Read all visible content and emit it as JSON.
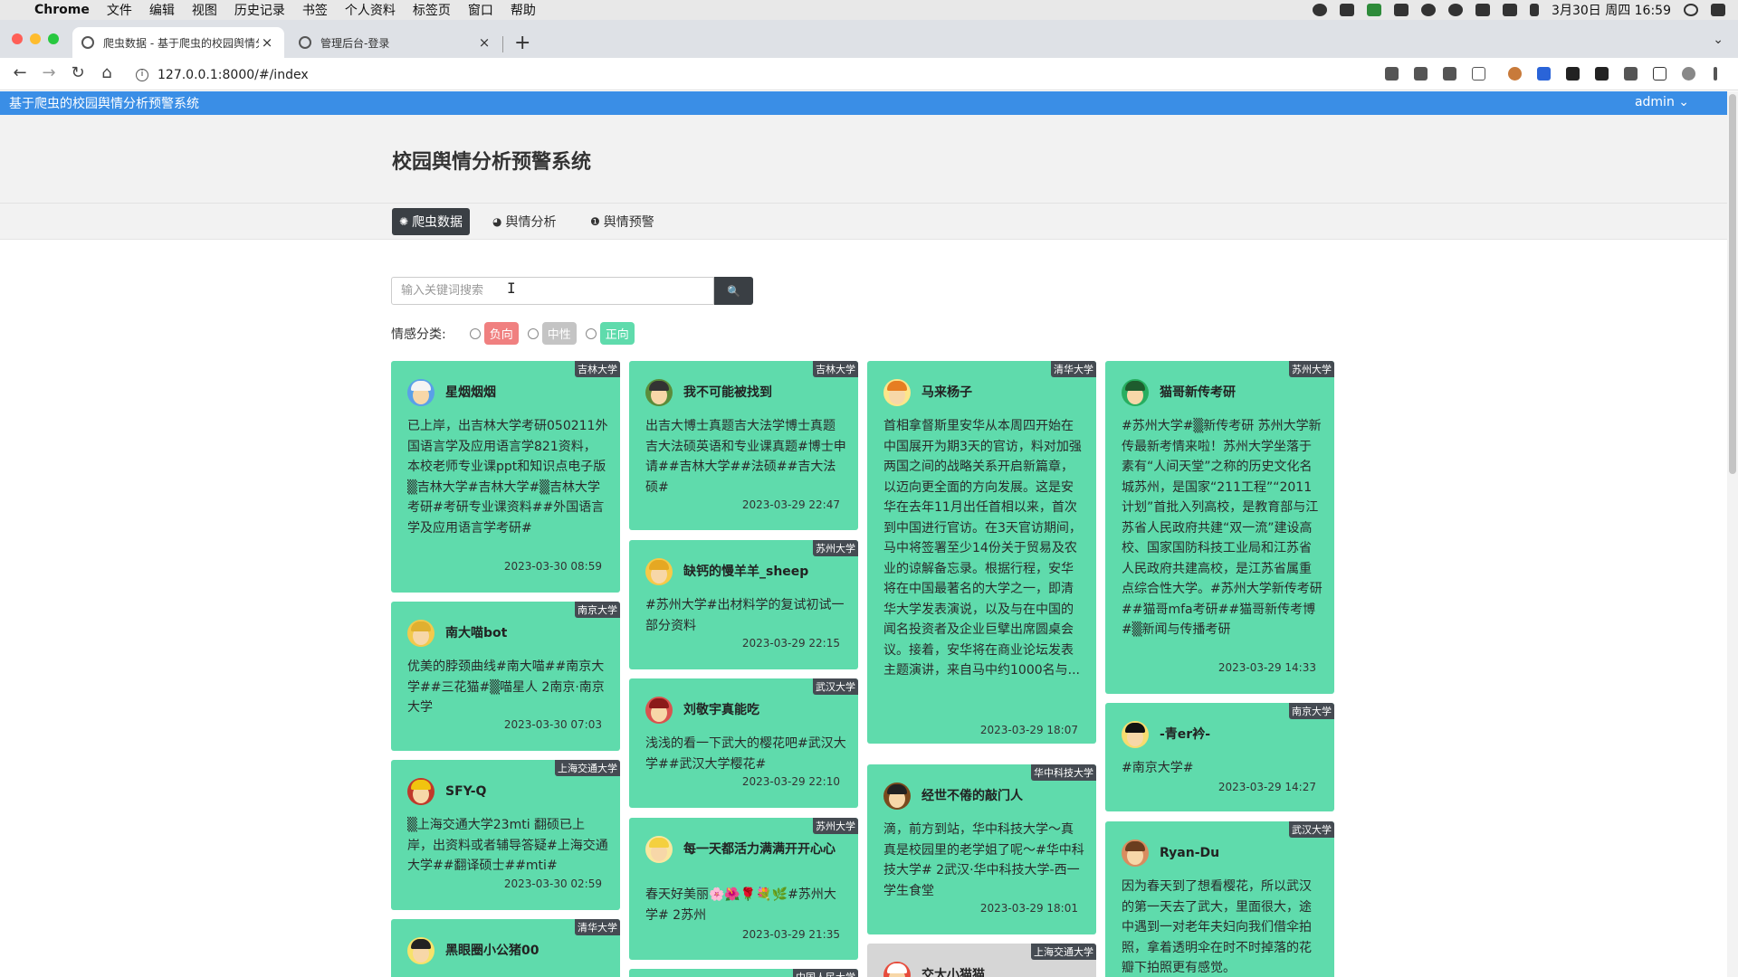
{
  "menubar": {
    "app_name": "Chrome",
    "items": [
      "文件",
      "编辑",
      "视图",
      "历史记录",
      "书签",
      "个人资料",
      "标签页",
      "窗口",
      "帮助"
    ],
    "clock": "3月30日 周四  16:59"
  },
  "tabs": [
    {
      "title": "爬虫数据 - 基于爬虫的校园舆情分析",
      "close": "×"
    },
    {
      "title": "管理后台-登录",
      "close": "×"
    }
  ],
  "newtab": "+",
  "toolbar": {
    "url": "127.0.0.1:8000/#/index",
    "back": "←",
    "forward": "→",
    "reload": "↻",
    "home": "⌂"
  },
  "appbar": {
    "title": "基于爬虫的校园舆情分析预警系统",
    "user": "admin ⌄"
  },
  "page": {
    "heading": "校园舆情分析预警系统",
    "nav": [
      {
        "icon": "✺",
        "label": "爬虫数据"
      },
      {
        "icon": "◕",
        "label": "舆情分析"
      },
      {
        "icon": "❶",
        "label": "舆情预警"
      }
    ],
    "search": {
      "placeholder": "输入关键词搜索",
      "button": "🔍"
    },
    "sentiment": {
      "label": "情感分类:",
      "options": [
        {
          "label": "负向",
          "color": "#f08080"
        },
        {
          "label": "中性",
          "color": "#c4c4c4"
        },
        {
          "label": "正向",
          "color": "#5fdbac"
        }
      ]
    }
  },
  "cards": [
    {
      "school": "吉林大学",
      "name": "星烟烟烟",
      "content": "已上岸，出吉林大学考研050211外国语言学及应用语言学821资料，本校老师专业课ppt和知识点电子版▒吉林大学#吉林大学#▒吉林大学考研#考研专业课资料##外国语言学及应用语言学考研#",
      "date": "2023-03-30 08:59"
    },
    {
      "school": "南京大学",
      "name": "南大喵bot",
      "content": "优美的脖颈曲线#南大喵##南京大学##三花猫#▒喵星人 2南京·南京大学",
      "date": "2023-03-30 07:03"
    },
    {
      "school": "上海交通大学",
      "name": "SFY-Q",
      "content": "▒上海交通大学23mti 翻硕已上岸，出资料或者辅导答疑#上海交通大学##翻译硕士##mti#",
      "date": "2023-03-30 02:59"
    },
    {
      "school": "清华大学",
      "name": "黑眼圈小公猪00",
      "content": "",
      "date": ""
    },
    {
      "school": "吉林大学",
      "name": "我不可能被找到",
      "content": "出吉大博士真题吉大法学博士真题吉大法硕英语和专业课真题#博士申请##吉林大学##法硕##吉大法硕#",
      "date": "2023-03-29 22:47"
    },
    {
      "school": "苏州大学",
      "name": "缺钙的慢羊羊_sheep",
      "content": "#苏州大学#出材料学的复试初试一部分资料",
      "date": "2023-03-29 22:15"
    },
    {
      "school": "武汉大学",
      "name": "刘敬宇真能吃",
      "content": "浅浅的看一下武大的樱花吧#武汉大学##武汉大学樱花#",
      "date": "2023-03-29 22:10"
    },
    {
      "school": "苏州大学",
      "name": "每一天都活力满满开开心心",
      "content": "春天好美丽🌸🌺🌹💐🌿#苏州大学# 2苏州",
      "date": "2023-03-29 21:35"
    },
    {
      "school": "中国人民大学",
      "name": "",
      "content": "",
      "date": ""
    },
    {
      "school": "清华大学",
      "name": "马来杨子",
      "content": "首相拿督斯里安华从本周四开始在中国展开为期3天的官访，料对加强两国之间的战略关系开启新篇章，以迈向更全面的方向发展。这是安华在去年11月出任首相以来，首次到中国进行官访。在3天官访期间，马中将签署至少14份关于贸易及农业的谅解备忘录。根据行程，安华将在中国最著名的大学之一，即清华大学发表演说，以及与在中国的闻名投资者及企业巨擘出席圆桌会议。接着，安华将在商业论坛发表主题演讲，来自马中约1000名与...",
      "date": "2023-03-29 18:07"
    },
    {
      "school": "华中科技大学",
      "name": "经世不倦的敲门人",
      "content": "滴，前方到站，华中科技大学～真真是校园里的老学姐了呢～#华中科技大学# 2武汉·华中科技大学-西一学生食堂",
      "date": "2023-03-29 18:01"
    },
    {
      "school": "上海交通大学",
      "name": "交大小猫猫",
      "content": "",
      "date": ""
    },
    {
      "school": "苏州大学",
      "name": "猫哥新传考研",
      "content": "#苏州大学#▒新传考研 苏州大学新传最新考情来啦！苏州大学坐落于素有“人间天堂”之称的历史文化名城苏州，是国家“211工程”“2011计划”首批入列高校，是教育部与江苏省人民政府共建“双一流”建设高校、国家国防科技工业局和江苏省人民政府共建高校，是江苏省属重点综合性大学。#苏州大学新传考研##猫哥mfa考研##猫哥新传考博#▒新闻与传播考研",
      "date": "2023-03-29 14:33"
    },
    {
      "school": "南京大学",
      "name": "-青er衿-",
      "content": "#南京大学#",
      "date": "2023-03-29 14:27"
    },
    {
      "school": "武汉大学",
      "name": "Ryan-Du",
      "content": "因为春天到了想看樱花，所以武汉的第一天去了武大，里面很大，途中遇到一对老年夫妇向我们借伞拍照，拿着透明伞在时不时掉落的花瓣下拍照更有感觉。",
      "date": ""
    }
  ],
  "colors": {
    "appbar": "#3a8ee6",
    "card": "#5fdbac",
    "dark": "#3a3f44"
  }
}
